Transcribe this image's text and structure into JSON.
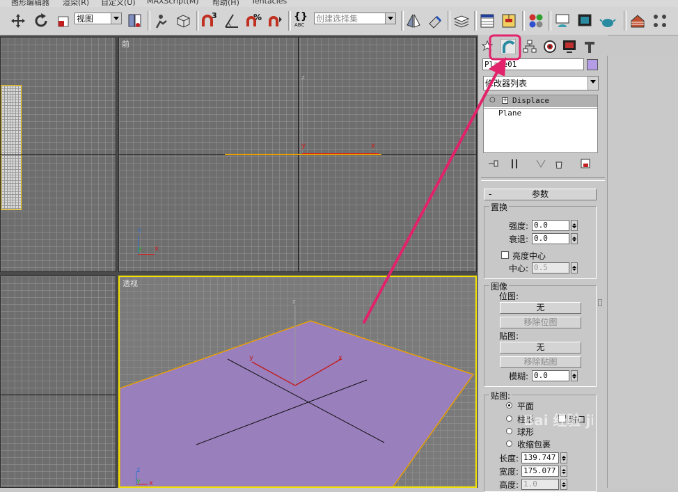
{
  "menu": [
    "图形编辑器",
    "渲染(R)",
    "自定义(U)",
    "MAXScript(M)",
    "帮助(H)",
    "Tentacles"
  ],
  "toolbar": {
    "view_combo": "视图",
    "snap_label": "3",
    "percent_label": "%",
    "selection_set_placeholder": "创建选择集",
    "abc_label": "ABC"
  },
  "viewports": {
    "front_label": "前",
    "persp_label": "透视",
    "axis_x": "x",
    "axis_y": "y",
    "axis_z": "z"
  },
  "panel": {
    "object_name": "Plane01",
    "modifier_list": "修改器列表",
    "stack": [
      "Displace",
      "Plane"
    ],
    "params_title": "参数",
    "collapse_sign": "-",
    "displace_group": "置换",
    "strength_label": "强度:",
    "strength_value": "0.0",
    "decay_label": "衰退:",
    "decay_value": "0.0",
    "luminance_center_label": "亮度中心",
    "center_label": "中心:",
    "center_value": "0.5",
    "image_group": "图像",
    "bitmap_label": "位图:",
    "bitmap_button": "无",
    "remove_bitmap": "移除位图",
    "map_label": "贴图:",
    "map_button": "无",
    "remove_map": "移除贴图",
    "blur_label": "模糊:",
    "blur_value": "0.0",
    "mapping_group": "贴图:",
    "planar": "平面",
    "cylindrical": "柱形",
    "cap": "封口",
    "spherical": "球形",
    "shrinkwrap": "收缩包裹",
    "length_label": "长度:",
    "length_value": "139.747",
    "width_label": "宽度:",
    "width_value": "175.077",
    "height_label": "高度:",
    "height_value": "1.0"
  },
  "colors": {
    "object_color": "#b49ce6",
    "plane_fill": "#9a7fbd",
    "annotation_pink": "#e2226a",
    "active_border": "#f2e000"
  },
  "watermark": "Bai 经验 jingyan.baidu.com"
}
